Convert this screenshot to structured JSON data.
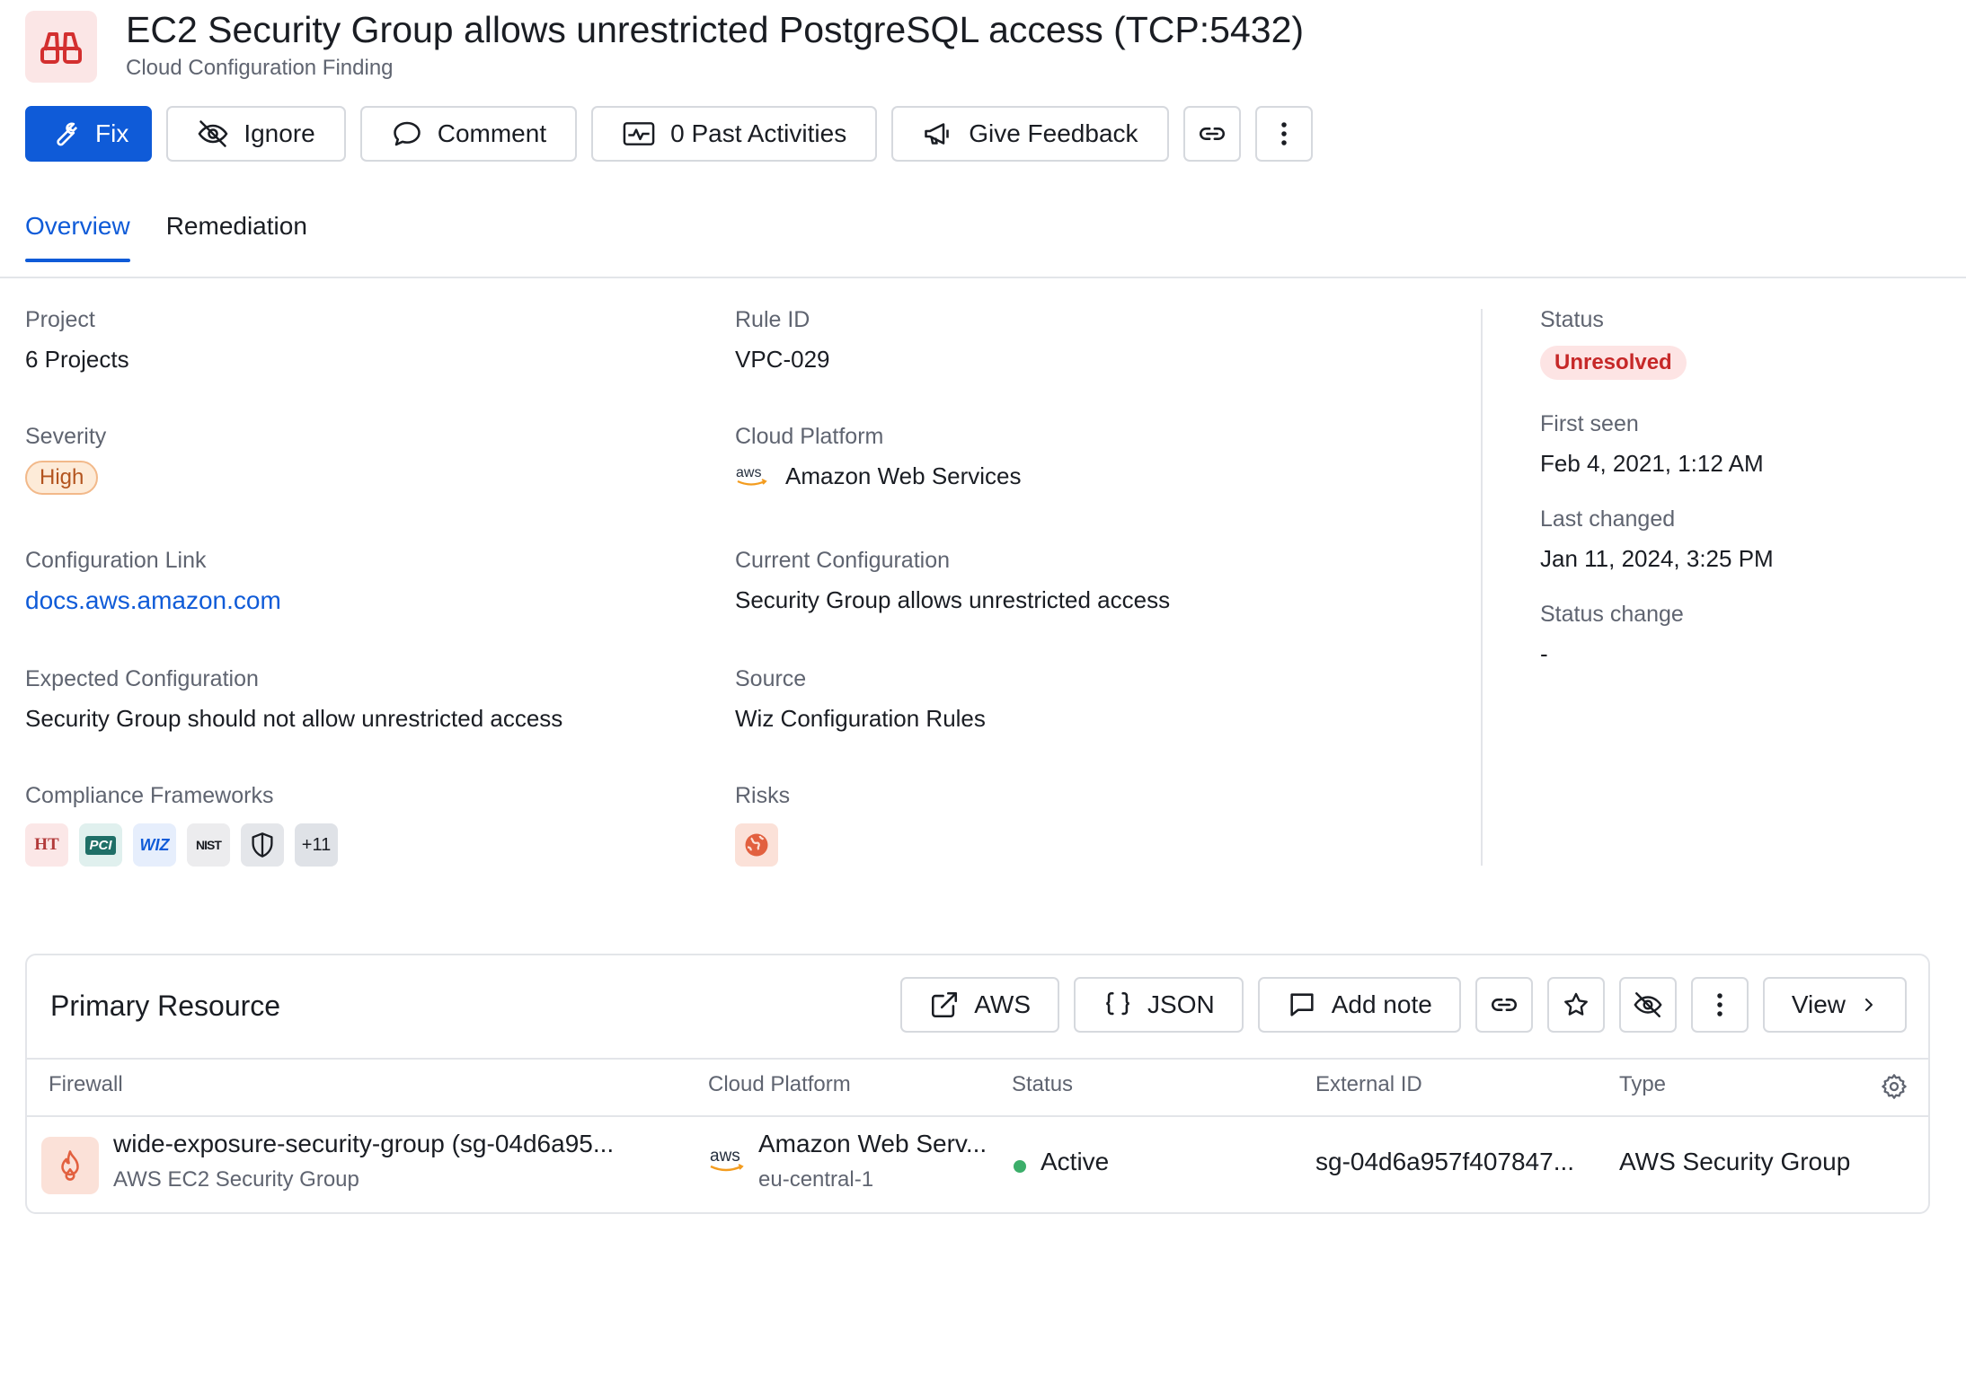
{
  "header": {
    "title": "EC2 Security Group allows unrestricted PostgreSQL access (TCP:5432)",
    "subtitle": "Cloud Configuration Finding",
    "icon": "binoculars-icon"
  },
  "toolbar": {
    "fix": "Fix",
    "ignore": "Ignore",
    "comment": "Comment",
    "past_activities": "0 Past Activities",
    "give_feedback": "Give Feedback"
  },
  "tabs": [
    {
      "label": "Overview",
      "active": true
    },
    {
      "label": "Remediation",
      "active": false
    }
  ],
  "details": {
    "project": {
      "label": "Project",
      "value": "6 Projects"
    },
    "severity": {
      "label": "Severity",
      "value": "High"
    },
    "config_link": {
      "label": "Configuration Link",
      "value": "docs.aws.amazon.com"
    },
    "expected": {
      "label": "Expected Configuration",
      "value": "Security Group should not allow unrestricted access"
    },
    "compliance": {
      "label": "Compliance Frameworks",
      "more": "+11",
      "badges": [
        "HT",
        "PCI",
        "WIZ",
        "NIST",
        "shield"
      ]
    },
    "rule_id": {
      "label": "Rule ID",
      "value": "VPC-029"
    },
    "cloud_platform": {
      "label": "Cloud Platform",
      "value": "Amazon Web Services",
      "logo": "aws"
    },
    "current": {
      "label": "Current Configuration",
      "value": "Security Group allows unrestricted access"
    },
    "source": {
      "label": "Source",
      "value": "Wiz Configuration Rules"
    },
    "risks": {
      "label": "Risks",
      "icon": "globe-icon"
    }
  },
  "status_panel": {
    "status": {
      "label": "Status",
      "value": "Unresolved"
    },
    "first_seen": {
      "label": "First seen",
      "value": "Feb 4, 2021, 1:12 AM"
    },
    "last_changed": {
      "label": "Last changed",
      "value": "Jan 11, 2024, 3:25 PM"
    },
    "status_change": {
      "label": "Status change",
      "value": "-"
    }
  },
  "primary_resource": {
    "title": "Primary Resource",
    "buttons": {
      "aws": "AWS",
      "json": "JSON",
      "add_note": "Add note",
      "view": "View"
    },
    "columns": [
      "Firewall",
      "Cloud Platform",
      "Status",
      "External ID",
      "Type"
    ],
    "row": {
      "name": "wide-exposure-security-group (sg-04d6a95...",
      "name_sub": "AWS EC2 Security Group",
      "platform_logo": "aws",
      "platform": "Amazon Web Serv...",
      "region": "eu-central-1",
      "status": "Active",
      "external_id": "sg-04d6a957f407847...",
      "type": "AWS Security Group"
    }
  },
  "colors": {
    "primary": "#0f5bd8",
    "danger": "#c62828",
    "warning": "#b3541e",
    "success": "#3cae6a"
  }
}
